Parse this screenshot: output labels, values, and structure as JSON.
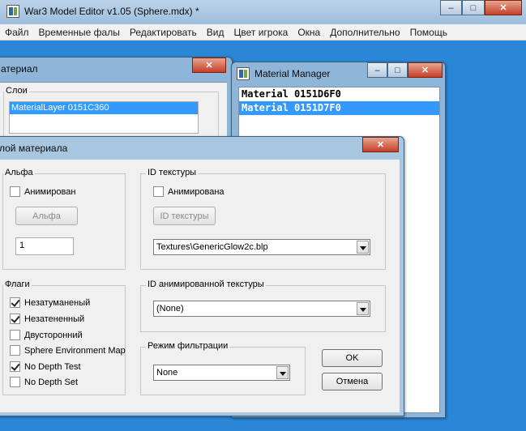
{
  "main": {
    "title": "War3 Model Editor v1.05 (Sphere.mdx) *",
    "menu": [
      "Файл",
      "Временные фалы",
      "Редактировать",
      "Вид",
      "Цвет игрока",
      "Окна",
      "Дополнительно",
      "Помощь"
    ],
    "buttons": {
      "minimize": "–",
      "maximize": "□",
      "close": "✕"
    }
  },
  "material_window": {
    "title": "атериал",
    "layers_label": "Слои",
    "layers": [
      "MaterialLayer 0151C360"
    ]
  },
  "material_manager": {
    "title": "Material Manager",
    "items": [
      "Material 0151D6F0",
      "Material 0151D7F0"
    ],
    "selected_index": 1
  },
  "layer_dialog": {
    "title": "лой материала",
    "alpha": {
      "label": "Альфа",
      "animated_label": "Анимирован",
      "animated_checked": false,
      "button_label": "Альфа",
      "value": "1"
    },
    "texture_id": {
      "label": "ID текстуры",
      "animated_label": "Анимирована",
      "animated_checked": false,
      "button_label": "ID текстуры",
      "selected": "Textures\\GenericGlow2c.blp"
    },
    "flags": {
      "label": "Флаги",
      "items": [
        {
          "label": "Незатуманеный",
          "checked": true
        },
        {
          "label": "Незатененный",
          "checked": true
        },
        {
          "label": "Двусторонний",
          "checked": false
        },
        {
          "label": "Sphere Environment Map",
          "checked": false
        },
        {
          "label": "No Depth Test",
          "checked": true
        },
        {
          "label": "No Depth Set",
          "checked": false
        }
      ]
    },
    "animated_texture_id": {
      "label": "ID анимированной текстуры",
      "selected": "(None)"
    },
    "filter_mode": {
      "label": "Режим фильтрации",
      "selected": "None"
    },
    "ok_label": "OK",
    "cancel_label": "Отмена"
  }
}
